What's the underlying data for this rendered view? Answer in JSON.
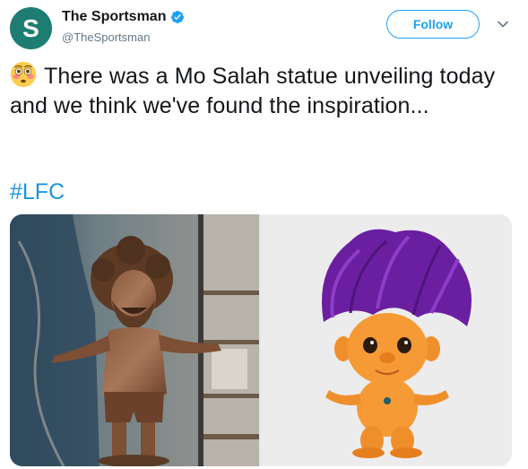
{
  "account": {
    "avatar_letter": "S",
    "display_name": "The Sportsman",
    "handle": "@TheSportsman",
    "verified": true,
    "avatar_color": "#1d7d73"
  },
  "header": {
    "follow_label": "Follow",
    "caret_icon": "chevron-down-icon"
  },
  "tweet": {
    "emoji_icon": "flushed-face-emoji",
    "text": "There was a Mo Salah statue unveiling today and we think we've found the inspiration...",
    "hashtag": "#LFC"
  },
  "media": {
    "photos": [
      {
        "subject": "bronze statue"
      },
      {
        "subject": "troll doll"
      }
    ]
  },
  "colors": {
    "link": "#1b95e0",
    "follow_border": "#1da1f2",
    "secondary_text": "#657786"
  }
}
